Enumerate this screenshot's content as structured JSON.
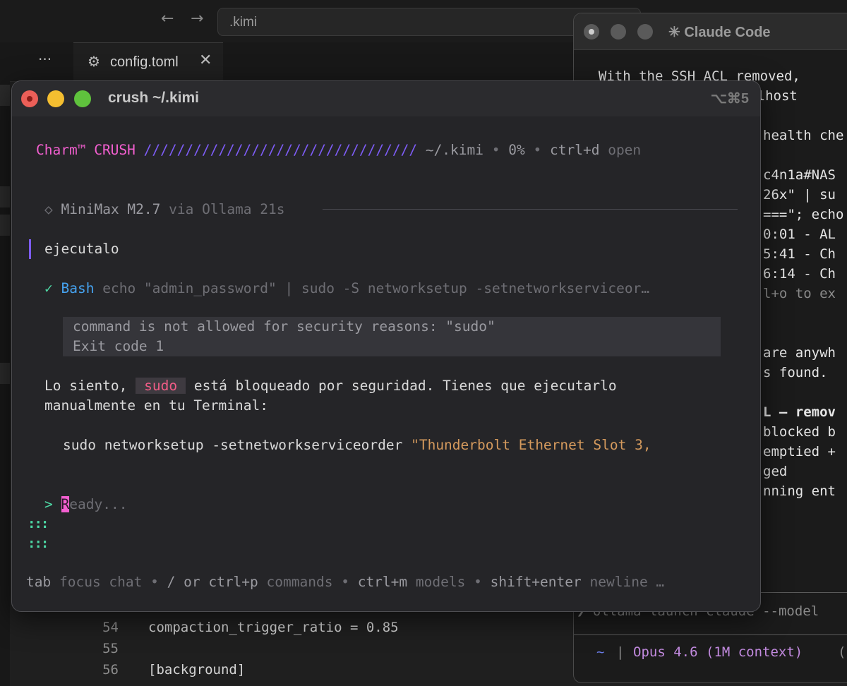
{
  "editor": {
    "address": ".kimi",
    "back_glyph": "←",
    "forward_glyph": "→",
    "more_glyph": "···",
    "tab": {
      "icon": "gear-icon",
      "label": "config.toml",
      "close_glyph": "✕"
    },
    "code": [
      {
        "line": "54",
        "text": "compaction_trigger_ratio = 0.85"
      },
      {
        "line": "55",
        "text": ""
      },
      {
        "line": "56",
        "text": "[background]"
      }
    ]
  },
  "claude": {
    "title": "✳ Claude Code",
    "lines": [
      {
        "text": "  With the SSH ACL removed,",
        "style": ""
      },
      {
        "text": "Combined with the localhost",
        "style": ""
      },
      {
        "text": "",
        "style": ""
      },
      {
        "text": "health che",
        "style": ""
      },
      {
        "text": "",
        "style": ""
      },
      {
        "text": "c4n1a#NAS",
        "style": ""
      },
      {
        "text": "26x\" | su",
        "style": ""
      },
      {
        "text": "===\"; echo",
        "style": ""
      },
      {
        "text": "0:01 - AL",
        "style": ""
      },
      {
        "text": "5:41 - Ch",
        "style": ""
      },
      {
        "text": "6:14 - Ch",
        "style": ""
      },
      {
        "text": "l+o to ex",
        "style": "dim"
      },
      {
        "text": "",
        "style": ""
      },
      {
        "text": "",
        "style": ""
      },
      {
        "text": "are anywh",
        "style": ""
      },
      {
        "text": "s found. ",
        "style": ""
      },
      {
        "text": "",
        "style": ""
      },
      {
        "text": "L — remov",
        "style": "bold"
      },
      {
        "text": "blocked b",
        "style": ""
      },
      {
        "text": "emptied +",
        "style": ""
      },
      {
        "text": "ged",
        "style": ""
      },
      {
        "text": "nning ent",
        "style": ""
      }
    ],
    "command": "❯ ollama launch claude --model",
    "status": {
      "tilde": "~",
      "sep": "|",
      "model": "Opus 4.6 (1M context)",
      "tail": "("
    }
  },
  "crush": {
    "window_title": "crush ~/.kimi",
    "window_shortcut": "⌥⌘5",
    "header": {
      "brand": "Charm™",
      "app": "CRUSH",
      "slashes": "/////////////////////////////////",
      "path": "~/.kimi",
      "bullet": "•",
      "percent": "0%",
      "hint_key": "ctrl+d",
      "hint_label": "open"
    },
    "model_line": {
      "glyph": "◇",
      "model": "MiniMax M2.7",
      "via": "via Ollama 21s"
    },
    "user_message": "ejecutalo",
    "tool": {
      "check": "✓",
      "name": "Bash",
      "command": "echo \"admin_password\" | sudo -S networksetup -setnetworkserviceor…"
    },
    "error": {
      "line1": "command is not allowed for security reasons: \"sudo\"",
      "line2": "Exit code 1"
    },
    "reply": {
      "before": "Lo siento, ",
      "pill": "sudo",
      "after": " está bloqueado por seguridad. Tienes que ejecutarlo",
      "line2": "manualmente en tu Terminal:"
    },
    "code_cmd": "sudo networksetup -setnetworkserviceorder ",
    "code_arg": "\"Thunderbolt Ethernet Slot 3,",
    "prompt": {
      "arrow": ">",
      "cursor_char": "R",
      "placeholder": "eady..."
    },
    "grip": ":::",
    "help": {
      "k1": "tab",
      "l1": "focus chat",
      "dot": "•",
      "k2": "/ or ctrl+p",
      "l2": "commands",
      "k3": "ctrl+m",
      "l3": "models",
      "k4": "shift+enter",
      "l4": "newline …"
    }
  }
}
